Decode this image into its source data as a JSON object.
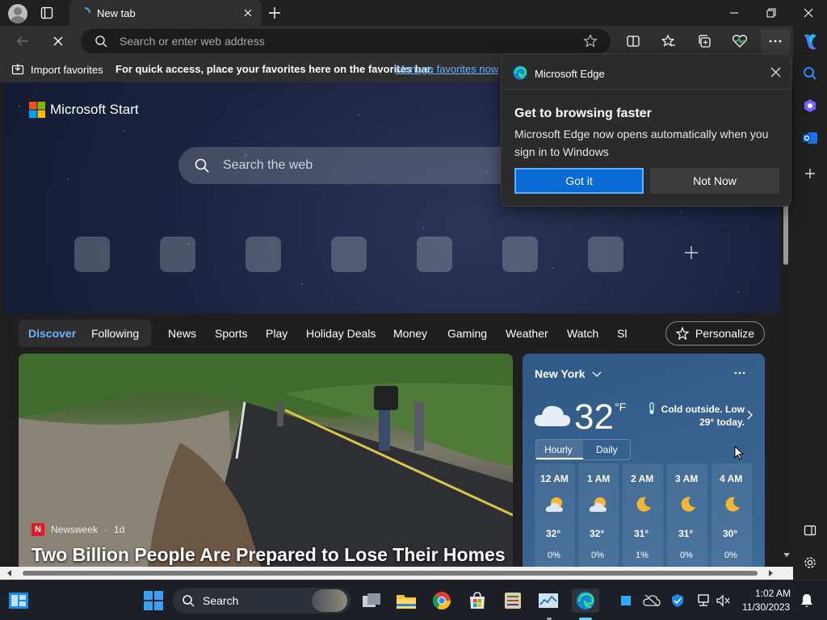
{
  "browser": {
    "tab_title": "New tab",
    "address_placeholder": "Search or enter web address"
  },
  "favorites_bar": {
    "import_label": "Import favorites",
    "hint": "For quick access, place your favorites here on the favorites bar.",
    "manage_link": "Manage favorites now"
  },
  "page": {
    "brand": "Microsoft Start",
    "search_placeholder": "Search the web",
    "nav": {
      "active": "Discover",
      "following": "Following",
      "items": [
        "News",
        "Sports",
        "Play",
        "Holiday Deals",
        "Money",
        "Gaming",
        "Weather",
        "Watch",
        "Sl"
      ],
      "personalize": "Personalize"
    },
    "news_card": {
      "source": "Newsweek",
      "age": "1d",
      "headline": "Two Billion People Are Prepared to Lose Their Homes"
    },
    "weather": {
      "city": "New York",
      "temperature": "32",
      "unit": "°F",
      "note": "Cold outside. Low 29° today.",
      "tabs": [
        "Hourly",
        "Daily"
      ],
      "hours": [
        {
          "time": "12 AM",
          "icon": "partly-cloudy-night-icon",
          "temp": "32°",
          "precip": "0%"
        },
        {
          "time": "1 AM",
          "icon": "partly-cloudy-night-icon",
          "temp": "32°",
          "precip": "0%"
        },
        {
          "time": "2 AM",
          "icon": "moon-icon",
          "temp": "31°",
          "precip": "1%"
        },
        {
          "time": "3 AM",
          "icon": "moon-icon",
          "temp": "31°",
          "precip": "0%"
        },
        {
          "time": "4 AM",
          "icon": "moon-icon",
          "temp": "30°",
          "precip": "0%"
        }
      ]
    }
  },
  "popup": {
    "app_name": "Microsoft Edge",
    "title": "Get to browsing faster",
    "body": "Microsoft Edge now opens automatically when you sign in to Windows",
    "primary": "Got it",
    "secondary": "Not Now"
  },
  "taskbar": {
    "search_label": "Search",
    "time": "1:02 AM",
    "date": "11/30/2023"
  },
  "colors": {
    "accent": "#0b6bd6",
    "link": "#6ab4ff",
    "discover": "#6ab4ff"
  }
}
